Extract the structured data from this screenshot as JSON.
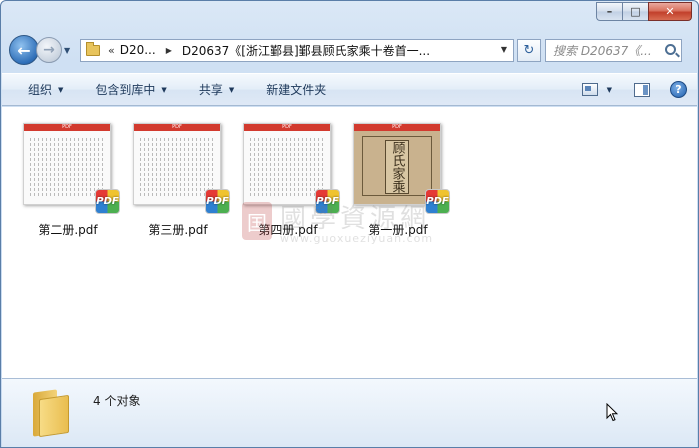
{
  "window": {
    "caption": {
      "minimize": "–",
      "maximize": "□",
      "close": "✕"
    }
  },
  "nav": {
    "back_icon": "←",
    "forward_icon": "→",
    "address": {
      "overflow": "«",
      "crumbs": [
        "D20...",
        "D20637《[浙江鄞县]鄞县顾氏家乘十卷首一..."
      ]
    },
    "refresh_icon": "↻",
    "search": {
      "placeholder": "搜索 D20637《..."
    }
  },
  "toolbar": {
    "organize": "组织",
    "include_library": "包含到库中",
    "share": "共享",
    "new_folder": "新建文件夹"
  },
  "files": [
    {
      "name": "第二册.pdf",
      "thumb_type": "text"
    },
    {
      "name": "第三册.pdf",
      "thumb_type": "text"
    },
    {
      "name": "第四册.pdf",
      "thumb_type": "text"
    },
    {
      "name": "第一册.pdf",
      "thumb_type": "cover",
      "cover_text": "顾氏家乘"
    }
  ],
  "thumb_header": "PDF",
  "badge_label": "PDF",
  "watermark": {
    "seal": "国",
    "chinese": "國學資源網",
    "url": "www.guoxueziyuan.com"
  },
  "status": {
    "item_count": "4 个对象"
  },
  "colors": {
    "accent": "#1e395b",
    "pdf_red": "#d23a2e"
  }
}
